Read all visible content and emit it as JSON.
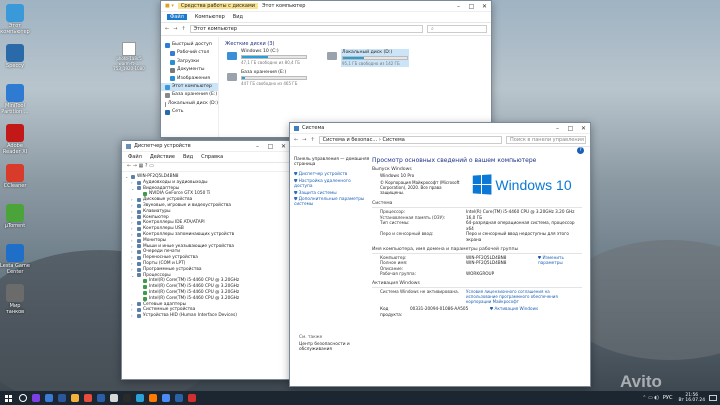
{
  "desktop_icons": [
    {
      "label": "Этот компьютер",
      "color": "#3a9ad9"
    },
    {
      "label": "Speccy",
      "color": "#2b6aa8"
    },
    {
      "label": "MiniTool Partition …",
      "color": "#2e7bd1"
    },
    {
      "label": "Adobe Reader XI",
      "color": "#c21818"
    },
    {
      "label": "CCleaner",
      "color": "#d83b2a"
    },
    {
      "label": "µTorrent",
      "color": "#4aa43a"
    },
    {
      "label": "Lesta Game Center",
      "color": "#1f6fc9"
    },
    {
      "label": "Мир танков",
      "color": "#6b6b6b"
    }
  ],
  "file_label": "photo-1a8c5 warm-ft-…753_1920-1080",
  "explorer": {
    "title": "Этот компьютер",
    "menu": [
      "Файл",
      "Компьютер",
      "Вид"
    ],
    "qa": "Средства работы с дисками",
    "address": "Этот компьютер",
    "section": "Жесткие диски (3)",
    "sidebar": [
      "Быстрый доступ",
      "Рабочий стол",
      "Загрузки",
      "Документы",
      "Изображения",
      "Этот компьютер",
      "База хранения (E:)",
      "Локальный диск (D:)",
      "Сеть"
    ],
    "drives": [
      {
        "name": "Windows 10 (C:)",
        "free": "47,1 ГБ свободно из 80,4 ГБ",
        "used": 0.41
      },
      {
        "name": "Локальный диск (D:)",
        "free": "95,1 ГБ свободно из 142 ГБ",
        "used": 0.33
      },
      {
        "name": "База хранения (E:)",
        "free": "447 ГБ свободно из 465 ГБ",
        "used": 0.04
      }
    ]
  },
  "devmgr": {
    "title": "Диспетчер устройств",
    "menu": [
      "Файл",
      "Действие",
      "Вид",
      "Справка"
    ],
    "root": "WIN-PF2Q5LD4BN8",
    "items": [
      {
        "t": "Аудиовходы и аудиовыходы",
        "l": 1,
        "a": "›"
      },
      {
        "t": "Видеоадаптеры",
        "l": 1,
        "a": "⌄"
      },
      {
        "t": "NVIDIA GeForce GTX 1050 Ti",
        "l": 2,
        "a": ""
      },
      {
        "t": "Дисковые устройства",
        "l": 1,
        "a": "›"
      },
      {
        "t": "Звуковые, игровые и видеоустройства",
        "l": 1,
        "a": "›"
      },
      {
        "t": "Клавиатуры",
        "l": 1,
        "a": "›"
      },
      {
        "t": "Компьютер",
        "l": 1,
        "a": "›"
      },
      {
        "t": "Контроллеры IDE ATA/ATAPI",
        "l": 1,
        "a": "›"
      },
      {
        "t": "Контроллеры USB",
        "l": 1,
        "a": "›"
      },
      {
        "t": "Контроллеры запоминающих устройств",
        "l": 1,
        "a": "›"
      },
      {
        "t": "Мониторы",
        "l": 1,
        "a": "›"
      },
      {
        "t": "Мыши и иные указывающие устройства",
        "l": 1,
        "a": "›"
      },
      {
        "t": "Очереди печати",
        "l": 1,
        "a": "›"
      },
      {
        "t": "Переносные устройства",
        "l": 1,
        "a": "›"
      },
      {
        "t": "Порты (COM и LPT)",
        "l": 1,
        "a": "›"
      },
      {
        "t": "Программные устройства",
        "l": 1,
        "a": "›"
      },
      {
        "t": "Процессоры",
        "l": 1,
        "a": "⌄"
      },
      {
        "t": "Intel(R) Core(TM) i5-4460  CPU @ 3.20GHz",
        "l": 2,
        "a": ""
      },
      {
        "t": "Intel(R) Core(TM) i5-4460  CPU @ 3.20GHz",
        "l": 2,
        "a": ""
      },
      {
        "t": "Intel(R) Core(TM) i5-4460  CPU @ 3.20GHz",
        "l": 2,
        "a": ""
      },
      {
        "t": "Intel(R) Core(TM) i5-4460  CPU @ 3.20GHz",
        "l": 2,
        "a": ""
      },
      {
        "t": "Сетевые адаптеры",
        "l": 1,
        "a": "›"
      },
      {
        "t": "Системные устройства",
        "l": 1,
        "a": "›"
      },
      {
        "t": "Устройства HID (Human Interface Devices)",
        "l": 1,
        "a": "›"
      }
    ]
  },
  "system": {
    "title": "Система",
    "breadcrumb": "Система и безопас… › Система",
    "search": "Поиск в панели управления",
    "left": [
      "Панель управления — домашняя страница",
      "Диспетчер устройств",
      "Настройка удаленного доступа",
      "Защита системы",
      "Дополнительные параметры системы"
    ],
    "see_also": "См. также",
    "see_also_link": "Центр безопасности и обслуживания",
    "heading": "Просмотр основных сведений о вашем компьютере",
    "edition_h": "Выпуск Windows",
    "edition": "Windows 10 Pro",
    "copyright": "© Корпорация Майкрософт (Microsoft Corporation), 2020. Все права защищены.",
    "logo": "Windows 10",
    "system_h": "Система",
    "sys_rows": [
      {
        "k": "Процессор:",
        "v": "Intel(R) Core(TM) i5-4460  CPU @ 3.20GHz   3.20 GHz"
      },
      {
        "k": "Установленная память (ОЗУ):",
        "v": "16,0 ГБ"
      },
      {
        "k": "Тип системы:",
        "v": "64-разрядная операционная система, процессор x64"
      },
      {
        "k": "Перо и сенсорный ввод:",
        "v": "Перо и сенсорный ввод недоступны для этого экрана"
      }
    ],
    "name_h": "Имя компьютера, имя домена и параметры рабочей группы",
    "change": "Изменить параметры",
    "name_rows": [
      {
        "k": "Компьютер:",
        "v": "WIN-PF2Q5LD4BN8"
      },
      {
        "k": "Полное имя:",
        "v": "WIN-PF2Q5LD4BN8"
      },
      {
        "k": "Описание:",
        "v": ""
      },
      {
        "k": "Рабочая группа:",
        "v": "WORKGROUP"
      }
    ],
    "act_h": "Активация Windows",
    "act_status": "Система Windows не активирована.",
    "act_link": "Условия лицензионного соглашения на использование программного обеспечения корпорации Майкрософт",
    "key_label": "Код продукта:",
    "key": "00331-20094-01086-AA505",
    "activate": "Активация Windows"
  },
  "taskbar": {
    "lang": "РУС",
    "time": "21:56",
    "date": "Вт 16.07.24",
    "apps": [
      "#ffffff",
      "#7b3fe4",
      "#3a7bd5",
      "#2b579a",
      "#f3b23c",
      "#e94b3c",
      "#2a5fa8",
      "#d8d8d8",
      "#2a2a2a",
      "#2ba2d6",
      "#ff7a00",
      "#4c8bf5",
      "#2962a6",
      "#d32f2f"
    ]
  },
  "watermark": "Avito"
}
